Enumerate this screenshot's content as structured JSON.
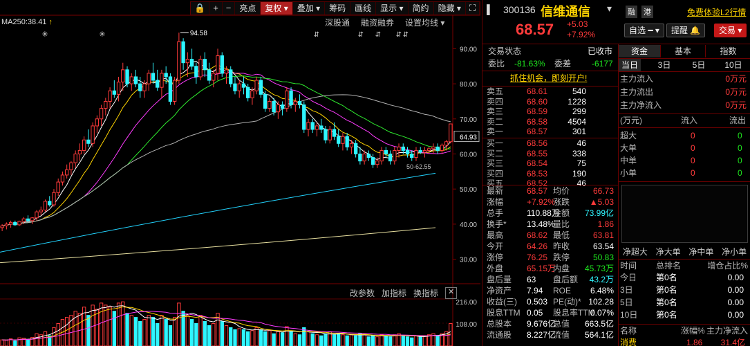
{
  "toolbar": {
    "items": [
      "亮点",
      "复权",
      "叠加",
      "筹码",
      "画线",
      "显示",
      "简约",
      "隐藏"
    ],
    "active": "复权",
    "dropdowns": [
      "复权",
      "叠加",
      "显示",
      "隐藏"
    ]
  },
  "ma250": {
    "label": "MA250:38.41"
  },
  "chart_tools_top": [
    "深股通",
    "融资融券",
    "设置均线"
  ],
  "chart_tools_bottom": [
    "改参数",
    "加指标",
    "换指标"
  ],
  "price_axis": {
    "ticks": [
      "90.00",
      "80.00",
      "70.00",
      "60.00",
      "50.00",
      "40.00",
      "30.00"
    ],
    "current": "64.93"
  },
  "vol_axis": {
    "ticks": [
      "216.00",
      "108.00"
    ]
  },
  "annotations": {
    "high": "94.58",
    "low": "50-62.55"
  },
  "stock": {
    "code": "300136",
    "name": "信维通信",
    "price": "68.57",
    "change": "+5.03",
    "pct": "+7.92%",
    "tags": [
      "融",
      "港"
    ],
    "promo": "免费体验L2行情"
  },
  "buttons": {
    "watch": "自选",
    "alert": "提醒",
    "trade": "交易"
  },
  "status": {
    "label": "交易状态",
    "value": "已收市"
  },
  "ratio": {
    "wb_label": "委比",
    "wb_value": "-81.63%",
    "wc_label": "委差",
    "wc_value": "-6177"
  },
  "ad": "抓住机会，即刻开户!",
  "sells": [
    {
      "label": "卖五",
      "price": "68.61",
      "vol": "540"
    },
    {
      "label": "卖四",
      "price": "68.60",
      "vol": "1228"
    },
    {
      "label": "卖三",
      "price": "68.59",
      "vol": "299"
    },
    {
      "label": "卖二",
      "price": "68.58",
      "vol": "4504"
    },
    {
      "label": "卖一",
      "price": "68.57",
      "vol": "301"
    }
  ],
  "buys": [
    {
      "label": "买一",
      "price": "68.56",
      "vol": "46"
    },
    {
      "label": "买二",
      "price": "68.55",
      "vol": "338"
    },
    {
      "label": "买三",
      "price": "68.54",
      "vol": "75"
    },
    {
      "label": "买四",
      "price": "68.53",
      "vol": "190"
    },
    {
      "label": "买五",
      "price": "68.52",
      "vol": "46"
    }
  ],
  "stats": [
    {
      "l1": "最新",
      "v1": "68.57",
      "c1": "red",
      "l2": "均价",
      "v2": "66.73",
      "c2": "red"
    },
    {
      "l1": "涨幅",
      "v1": "+7.92%",
      "c1": "red",
      "l2": "涨跌",
      "v2": "▲5.03",
      "c2": "red"
    },
    {
      "l1": "总手",
      "v1": "110.88万",
      "c1": "white",
      "l2": "金额",
      "v2": "73.99亿",
      "c2": "cyan"
    },
    {
      "l1": "换手*",
      "v1": "13.48%",
      "c1": "white",
      "l2": "量比",
      "v2": "1.86",
      "c2": "red"
    },
    {
      "l1": "最高",
      "v1": "68.62",
      "c1": "red",
      "l2": "最低",
      "v2": "63.81",
      "c2": "red"
    },
    {
      "l1": "今开",
      "v1": "64.26",
      "c1": "red",
      "l2": "昨收",
      "v2": "63.54",
      "c2": "white"
    },
    {
      "l1": "涨停",
      "v1": "76.25",
      "c1": "red",
      "l2": "跌停",
      "v2": "50.83",
      "c2": "green"
    },
    {
      "l1": "外盘",
      "v1": "65.15万",
      "c1": "red",
      "l2": "内盘",
      "v2": "45.73万",
      "c2": "green"
    },
    {
      "l1": "盘后量",
      "v1": "63",
      "c1": "white",
      "l2": "盘后额",
      "v2": "43.2万",
      "c2": "cyan"
    },
    {
      "l1": "净资产",
      "v1": "7.94",
      "c1": "white",
      "l2": "ROE",
      "v2": "6.48%",
      "c2": "white"
    },
    {
      "l1": "收益(三)",
      "v1": "0.503",
      "c1": "white",
      "l2": "PE(动)*",
      "v2": "102.28",
      "c2": "white"
    },
    {
      "l1": "股息TTM",
      "v1": "0.05",
      "c1": "white",
      "l2": "股息率TTM",
      "v2": "0.07%",
      "c2": "white"
    },
    {
      "l1": "总股本",
      "v1": "9.676亿",
      "c1": "white",
      "l2": "总值",
      "v2": "663.5亿",
      "c2": "white"
    },
    {
      "l1": "流通股",
      "v1": "8.227亿",
      "c1": "white",
      "l2": "流值",
      "v2": "564.1亿",
      "c2": "white"
    }
  ],
  "fund_tabs": [
    "资金",
    "基本",
    "指数"
  ],
  "period_tabs": [
    "当日",
    "3日",
    "5日",
    "10日"
  ],
  "flows": [
    {
      "label": "主力流入",
      "value": "0万元"
    },
    {
      "label": "主力流出",
      "value": "0万元"
    },
    {
      "label": "主力净流入",
      "value": "0万元"
    }
  ],
  "flow_table": {
    "unit": "(万元)",
    "in": "流入",
    "out": "流出",
    "rows": [
      {
        "label": "超大",
        "in": "0",
        "out": "0"
      },
      {
        "label": "大单",
        "in": "0",
        "out": "0"
      },
      {
        "label": "中单",
        "in": "0",
        "out": "0"
      },
      {
        "label": "小单",
        "in": "0",
        "out": "0"
      }
    ]
  },
  "net_labels": [
    "净超大",
    "净大单",
    "净中单",
    "净小单"
  ],
  "rank": {
    "headers": [
      "时间",
      "总排名",
      "增仓占比%"
    ],
    "rows": [
      {
        "t": "今日",
        "r": "第0名",
        "p": "0.00"
      },
      {
        "t": "3日",
        "r": "第0名",
        "p": "0.00"
      },
      {
        "t": "5日",
        "r": "第0名",
        "p": "0.00"
      },
      {
        "t": "10日",
        "r": "第0名",
        "p": "0.00"
      }
    ]
  },
  "sector": {
    "headers": [
      "名称",
      "涨幅%",
      "主力净流入"
    ],
    "row": {
      "name": "消费",
      "pct": "1.86",
      "flow": "31.4亿"
    }
  },
  "chart_data": {
    "type": "candlestick",
    "ylim": [
      24,
      96
    ],
    "vol_ylim": [
      0,
      230
    ],
    "candles": [
      [
        39,
        40,
        38,
        39.5
      ],
      [
        39.5,
        40.5,
        38.5,
        40
      ],
      [
        40,
        41,
        39,
        40.5
      ],
      [
        40.5,
        41,
        39.5,
        39.8
      ],
      [
        39.8,
        41,
        39.5,
        40.8
      ],
      [
        40.8,
        42,
        40,
        41.5
      ],
      [
        41.5,
        42.5,
        40.5,
        41
      ],
      [
        41,
        42,
        40,
        41.8
      ],
      [
        41.8,
        44,
        41,
        43.5
      ],
      [
        43.5,
        45,
        42.5,
        44
      ],
      [
        44,
        47,
        43.5,
        46.5
      ],
      [
        46.5,
        48,
        45,
        45.5
      ],
      [
        45.5,
        50,
        45,
        49
      ],
      [
        49,
        53,
        48,
        52
      ],
      [
        52,
        55,
        51,
        54
      ],
      [
        54,
        57,
        53,
        55.5
      ],
      [
        55.5,
        58,
        54,
        57.5
      ],
      [
        57.5,
        61,
        56,
        60
      ],
      [
        60,
        63,
        58,
        61
      ],
      [
        61,
        65,
        60,
        64
      ],
      [
        64,
        67,
        62,
        63
      ],
      [
        63,
        69,
        62,
        68
      ],
      [
        68,
        71,
        66,
        70
      ],
      [
        70,
        74,
        68,
        73
      ],
      [
        73,
        76,
        71,
        75
      ],
      [
        75,
        79,
        73,
        78
      ],
      [
        78,
        81,
        76,
        77
      ],
      [
        77,
        82,
        75,
        80.5
      ],
      [
        80.5,
        86,
        78,
        84
      ],
      [
        84,
        85,
        79,
        80
      ],
      [
        80,
        83,
        78,
        82
      ],
      [
        82,
        84,
        79,
        80
      ],
      [
        80,
        82,
        76,
        78
      ],
      [
        78,
        81,
        76,
        80
      ],
      [
        80,
        84,
        78,
        83
      ],
      [
        83,
        86,
        80,
        81
      ],
      [
        81,
        84,
        78,
        79
      ],
      [
        79,
        84,
        76,
        83
      ],
      [
        83,
        85,
        80,
        82
      ],
      [
        82,
        83,
        74,
        75
      ],
      [
        75,
        82,
        74,
        81
      ],
      [
        81,
        94.58,
        80,
        92
      ],
      [
        92,
        93,
        84,
        86
      ],
      [
        86,
        89,
        82,
        87
      ],
      [
        87,
        90,
        84,
        85
      ],
      [
        85,
        86,
        80,
        82
      ],
      [
        82,
        88,
        81,
        87
      ],
      [
        87,
        89,
        82,
        84
      ],
      [
        84,
        86,
        80,
        81
      ],
      [
        81,
        84,
        79,
        83
      ],
      [
        83,
        90,
        81,
        88
      ],
      [
        88,
        89,
        82,
        83
      ],
      [
        83,
        85,
        80,
        84
      ],
      [
        84,
        85,
        79,
        80
      ],
      [
        80,
        82,
        77,
        78
      ],
      [
        78,
        81,
        76,
        80
      ],
      [
        80,
        82,
        77,
        79
      ],
      [
        79,
        80,
        75,
        76
      ],
      [
        76,
        79,
        74,
        78
      ],
      [
        78,
        82,
        77,
        81
      ],
      [
        81,
        82,
        76,
        77
      ],
      [
        77,
        78,
        72,
        73
      ],
      [
        73,
        76,
        72,
        75
      ],
      [
        75,
        76,
        71,
        72
      ],
      [
        72,
        75,
        70,
        74
      ],
      [
        74,
        75,
        71,
        73
      ],
      [
        73,
        79,
        72,
        78
      ],
      [
        78,
        79,
        73,
        74
      ],
      [
        74,
        76,
        72,
        75
      ],
      [
        75,
        77,
        73,
        74
      ],
      [
        74,
        75,
        66,
        67
      ],
      [
        67,
        70,
        65,
        69
      ],
      [
        69,
        70,
        66,
        67
      ],
      [
        67,
        69,
        65,
        68
      ],
      [
        68,
        70,
        66,
        67
      ],
      [
        67,
        68,
        63,
        64
      ],
      [
        64,
        68,
        63,
        67
      ],
      [
        67,
        69,
        64,
        65
      ],
      [
        65,
        67,
        62,
        63
      ],
      [
        63,
        66,
        61,
        65
      ],
      [
        65,
        66,
        61,
        62
      ],
      [
        62,
        64,
        60,
        63
      ],
      [
        63,
        64,
        59,
        60
      ],
      [
        60,
        62,
        57,
        58
      ],
      [
        58,
        61,
        57,
        60
      ],
      [
        60,
        61,
        58,
        59
      ],
      [
        59,
        60,
        56,
        57
      ],
      [
        57,
        59,
        56,
        58
      ],
      [
        58,
        62,
        57,
        61
      ],
      [
        61,
        62,
        59,
        60
      ],
      [
        60,
        61,
        57,
        58
      ],
      [
        58,
        62,
        57,
        61
      ],
      [
        61,
        63,
        59,
        62
      ],
      [
        62,
        63,
        60,
        61
      ],
      [
        61,
        62,
        59,
        60
      ],
      [
        60,
        61,
        58,
        59
      ],
      [
        59,
        62,
        58,
        61
      ],
      [
        61,
        62,
        60,
        60.5
      ],
      [
        60.5,
        62,
        59,
        61
      ],
      [
        61,
        62,
        60,
        61.5
      ],
      [
        61.5,
        63,
        60,
        62
      ],
      [
        62,
        63,
        60,
        61
      ],
      [
        61,
        63,
        60,
        62.5
      ],
      [
        62.5,
        64,
        61,
        63.5
      ],
      [
        63.5,
        68.62,
        63,
        68.57
      ]
    ],
    "volumes": [
      30,
      28,
      35,
      25,
      40,
      38,
      30,
      42,
      60,
      55,
      70,
      50,
      90,
      110,
      130,
      140,
      150,
      170,
      160,
      190,
      150,
      200,
      180,
      210,
      200,
      190,
      170,
      210,
      216,
      160,
      150,
      140,
      120,
      130,
      150,
      140,
      110,
      150,
      130,
      100,
      140,
      210,
      170,
      150,
      130,
      110,
      150,
      120,
      100,
      110,
      160,
      120,
      100,
      90,
      80,
      85,
      80,
      70,
      75,
      90,
      80,
      70,
      75,
      60,
      70,
      65,
      95,
      70,
      60,
      55,
      90,
      70,
      60,
      55,
      50,
      60,
      70,
      55,
      60,
      55,
      50,
      55,
      50,
      60,
      55,
      45,
      50,
      45,
      55,
      50,
      45,
      55,
      60,
      50,
      45,
      40,
      50,
      45,
      50,
      55,
      60,
      50,
      60,
      70,
      110
    ]
  }
}
